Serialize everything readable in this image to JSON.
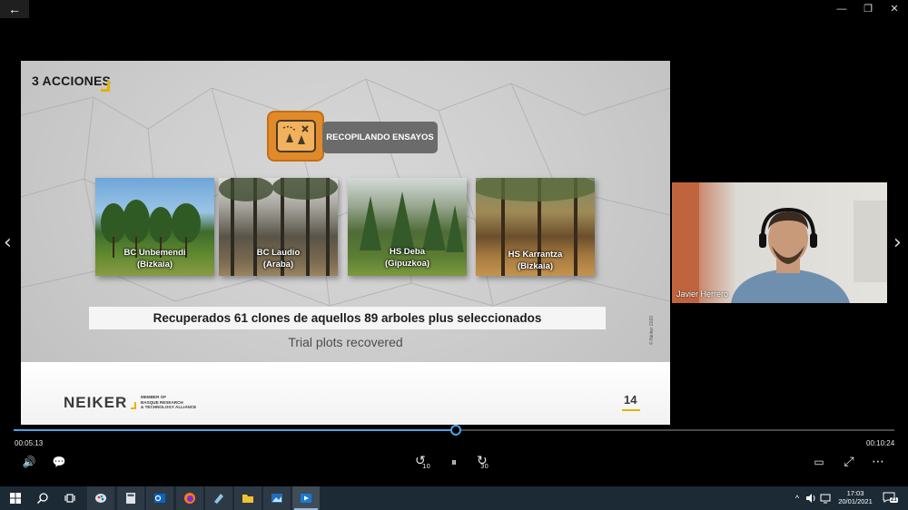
{
  "window": {
    "back_icon": "←",
    "minimize_icon": "—",
    "maximize_icon": "❐",
    "close_icon": "✕"
  },
  "navigation": {
    "prev_icon": "‹",
    "next_icon": "›"
  },
  "slide": {
    "heading": "3 ACCIONES",
    "section_label": "RECOPILANDO ENSAYOS",
    "photos": [
      {
        "line1": "BC Unbemendi",
        "line2": "(Bizkaia)"
      },
      {
        "line1": "BC Laudio",
        "line2": "(Araba)"
      },
      {
        "line1": "HS Deba",
        "line2": "(Gipuzkoa)"
      },
      {
        "line1": "HS Karrantza",
        "line2": "(Bizkaia)"
      }
    ],
    "clones_text": "Recuperados 61 clones de aquellos 89 arboles plus seleccionados",
    "trial_text": "Trial plots recovered",
    "copyright": "© Neiker 2020",
    "footer": {
      "logo": "NEIKER",
      "tag_line1": "MEMBER OF",
      "tag_line2": "BASQUE RESEARCH",
      "tag_line3": "& TECHNOLOGY ALLIANCE",
      "page_number": "14"
    }
  },
  "webcam": {
    "name": "Javier Herrero"
  },
  "player": {
    "elapsed": "00:05:13",
    "total": "00:10:24",
    "progress_fraction": 0.502,
    "volume_icon": "🔊",
    "captions_icon": "💬",
    "rewind_label": "10",
    "forward_label": "30",
    "pause_icon": "⏸",
    "miniview_icon": "▭",
    "fullscreen_icon": "⤢",
    "more_icon": "⋯"
  },
  "taskbar": {
    "time": "17:03",
    "date": "20/01/2021",
    "notification_count": "21",
    "chevron_icon": "^",
    "accent": "#8fbde8"
  }
}
